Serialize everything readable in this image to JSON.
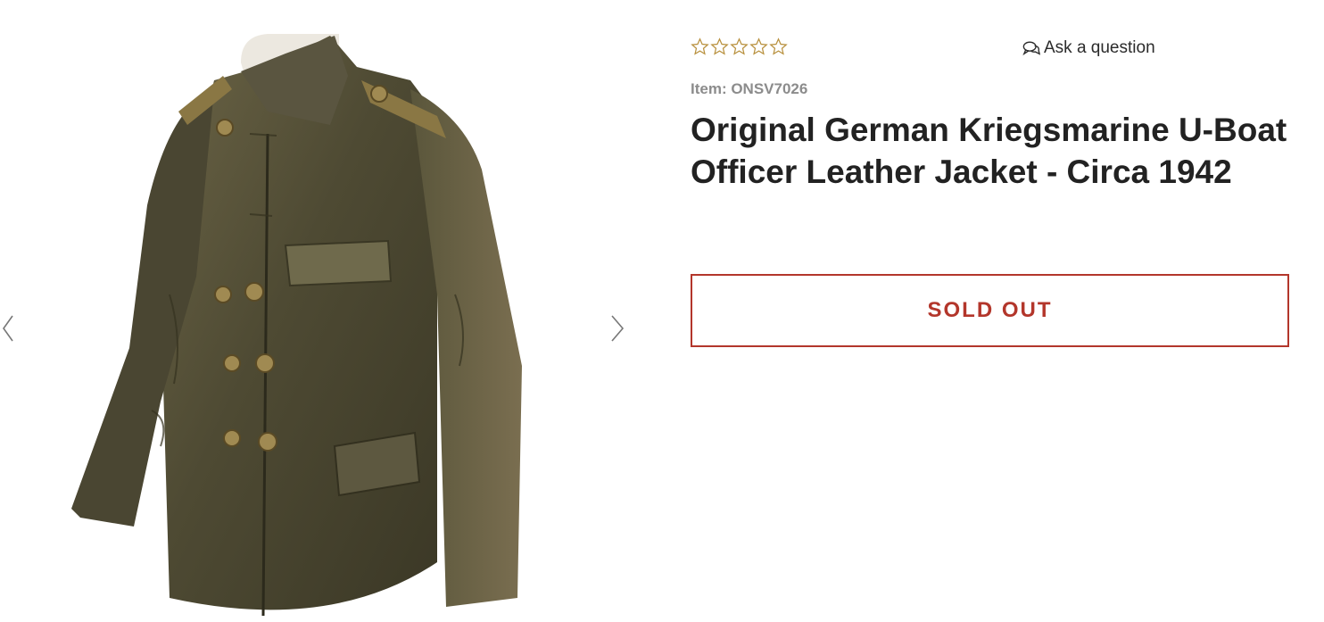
{
  "gallery": {
    "image_alt": "Original German Kriegsmarine U-Boat Officer Leather Jacket",
    "prev_icon": "chevron-left-icon",
    "next_icon": "chevron-right-icon"
  },
  "product": {
    "rating": 0,
    "rating_max": 5,
    "star_color": "#b8903d",
    "ask_label": "Ask a question",
    "ask_icon": "chat-bubbles-icon",
    "item_label": "Item: ONSV7026",
    "title": "Original German Kriegsmarine U-Boat Officer Leather Jacket - Circa 1942",
    "button_label": "SOLD OUT",
    "button_color": "#b3362b"
  }
}
